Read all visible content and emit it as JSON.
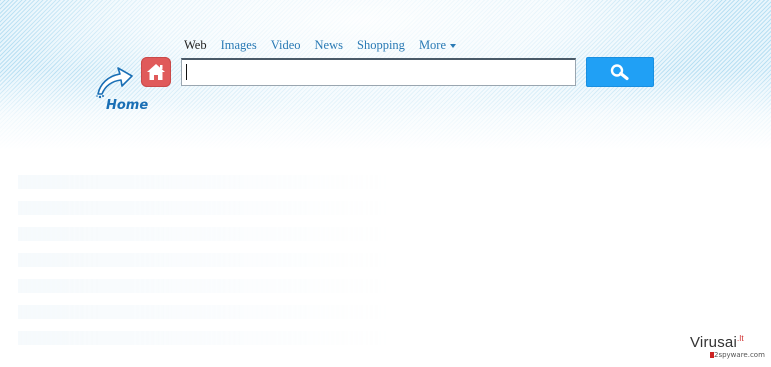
{
  "nav": {
    "items": [
      {
        "label": "Web",
        "active": true
      },
      {
        "label": "Images",
        "active": false
      },
      {
        "label": "Video",
        "active": false
      },
      {
        "label": "News",
        "active": false
      },
      {
        "label": "Shopping",
        "active": false
      }
    ],
    "more_label": "More"
  },
  "logo": {
    "text": "Home"
  },
  "search": {
    "value": "",
    "placeholder": ""
  },
  "icons": {
    "home": "house-icon",
    "logo": "arrow-logo-icon",
    "search": "magnifier-icon",
    "more": "chevron-down-icon"
  },
  "colors": {
    "link": "#2a7ab5",
    "active": "#222222",
    "search_button": "#20a0f5",
    "house_icon": "#e05a5a",
    "logo_text": "#1a6fb5"
  },
  "watermark": {
    "main": "Virusai",
    "suffix": ".lt",
    "sub": "2spyware.com"
  }
}
